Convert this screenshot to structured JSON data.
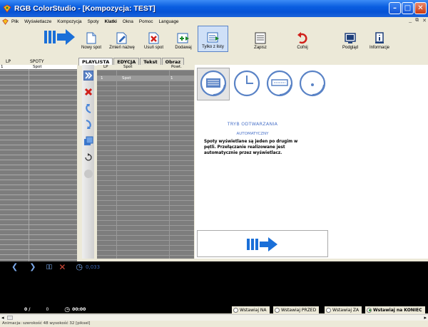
{
  "window": {
    "title": "RGB ColorStudio - [Kompozycja: TEST]"
  },
  "menu": [
    {
      "label": "Plik",
      "bold": false
    },
    {
      "label": "Wyświetlacze",
      "bold": false
    },
    {
      "label": "Kompozycja",
      "bold": false
    },
    {
      "label": "Spoty",
      "bold": false
    },
    {
      "label": "Klatki",
      "bold": true
    },
    {
      "label": "Okna",
      "bold": false
    },
    {
      "label": "Pomoc",
      "bold": false
    },
    {
      "label": "Language",
      "bold": false
    }
  ],
  "toolbar": {
    "new_spot": "Nowy spot",
    "rename": "Zmień nazwę",
    "delete_spot": "Usuń spot",
    "add": "Dodawaj",
    "from_list": "Tylko z listy",
    "save": "Zapisz",
    "undo": "Cofnij",
    "preview": "Podgląd",
    "info": "Informacje"
  },
  "left_table": {
    "col_lp": "LP",
    "col_spoty": "SPOTY",
    "row": {
      "lp": "1",
      "name": "Spot"
    }
  },
  "tabs": [
    "PLAYLISTA",
    "EDYCJA",
    "Tekst",
    "Obraz"
  ],
  "mid_table": {
    "col_lp": "LP",
    "col_spot": "Spot",
    "col_powt": "Powt.",
    "row": {
      "lp": "1",
      "spot": "Spot",
      "powt": "1"
    }
  },
  "mode": {
    "title": "TRYB ODTWARZANIA",
    "subtitle": "AUTOMATYCZNY",
    "description": "Spoty wyświetlane są jeden po drugim w pętli. Przełączanie realizowane jest automatycznie przez wyświetlacz."
  },
  "player": {
    "time": "0,033"
  },
  "status": {
    "frame": "0 /",
    "count": "0",
    "clock": "00:00"
  },
  "insert_options": [
    {
      "label": "Wstawiaj NA",
      "checked": false
    },
    {
      "label": "Wstawiaj PRZED",
      "checked": false
    },
    {
      "label": "Wstawiaj ZA",
      "checked": false
    },
    {
      "label": "Wstawiaj na KONIEC",
      "checked": true
    }
  ],
  "footer": {
    "text": "Animacja: szerokość 48   wysokość 32   [piksel]"
  },
  "colors": {
    "accent": "#4a72c8",
    "title_blue": "#0a5ee0",
    "logo_blue": "#1a6fd8"
  }
}
